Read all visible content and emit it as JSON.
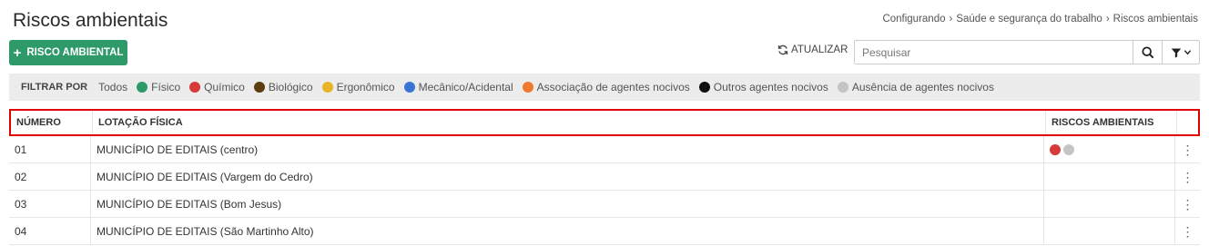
{
  "page": {
    "title": "Riscos ambientais"
  },
  "breadcrumb": [
    "Configurando",
    "Saúde e segurança do trabalho",
    "Riscos ambientais"
  ],
  "toolbar": {
    "add_label": "RISCO AMBIENTAL",
    "refresh_label": "ATUALIZAR",
    "search_placeholder": "Pesquisar"
  },
  "filters": {
    "label": "FILTRAR POR",
    "all": "Todos",
    "items": [
      {
        "label": "Físico",
        "color": "#2e9a6a"
      },
      {
        "label": "Químico",
        "color": "#d63a3a"
      },
      {
        "label": "Biológico",
        "color": "#5c3d11"
      },
      {
        "label": "Ergonômico",
        "color": "#e8b42a"
      },
      {
        "label": "Mecânico/Acidental",
        "color": "#3a74d6"
      },
      {
        "label": "Associação de agentes nocivos",
        "color": "#ee7a30"
      },
      {
        "label": "Outros agentes nocivos",
        "color": "#111111"
      },
      {
        "label": "Ausência de agentes nocivos",
        "color": "#c4c4c4"
      }
    ]
  },
  "table": {
    "headers": {
      "number": "NÚMERO",
      "location": "LOTAÇÃO FÍSICA",
      "risks": "RISCOS AMBIENTAIS"
    },
    "rows": [
      {
        "number": "01",
        "location": "MUNICÍPIO DE EDITAIS (centro)",
        "risks": [
          "#d63a3a",
          "#c4c4c4"
        ]
      },
      {
        "number": "02",
        "location": "MUNICÍPIO DE EDITAIS (Vargem do Cedro)",
        "risks": []
      },
      {
        "number": "03",
        "location": "MUNICÍPIO DE EDITAIS (Bom Jesus)",
        "risks": []
      },
      {
        "number": "04",
        "location": "MUNICÍPIO DE EDITAIS (São Martinho Alto)",
        "risks": []
      }
    ]
  }
}
